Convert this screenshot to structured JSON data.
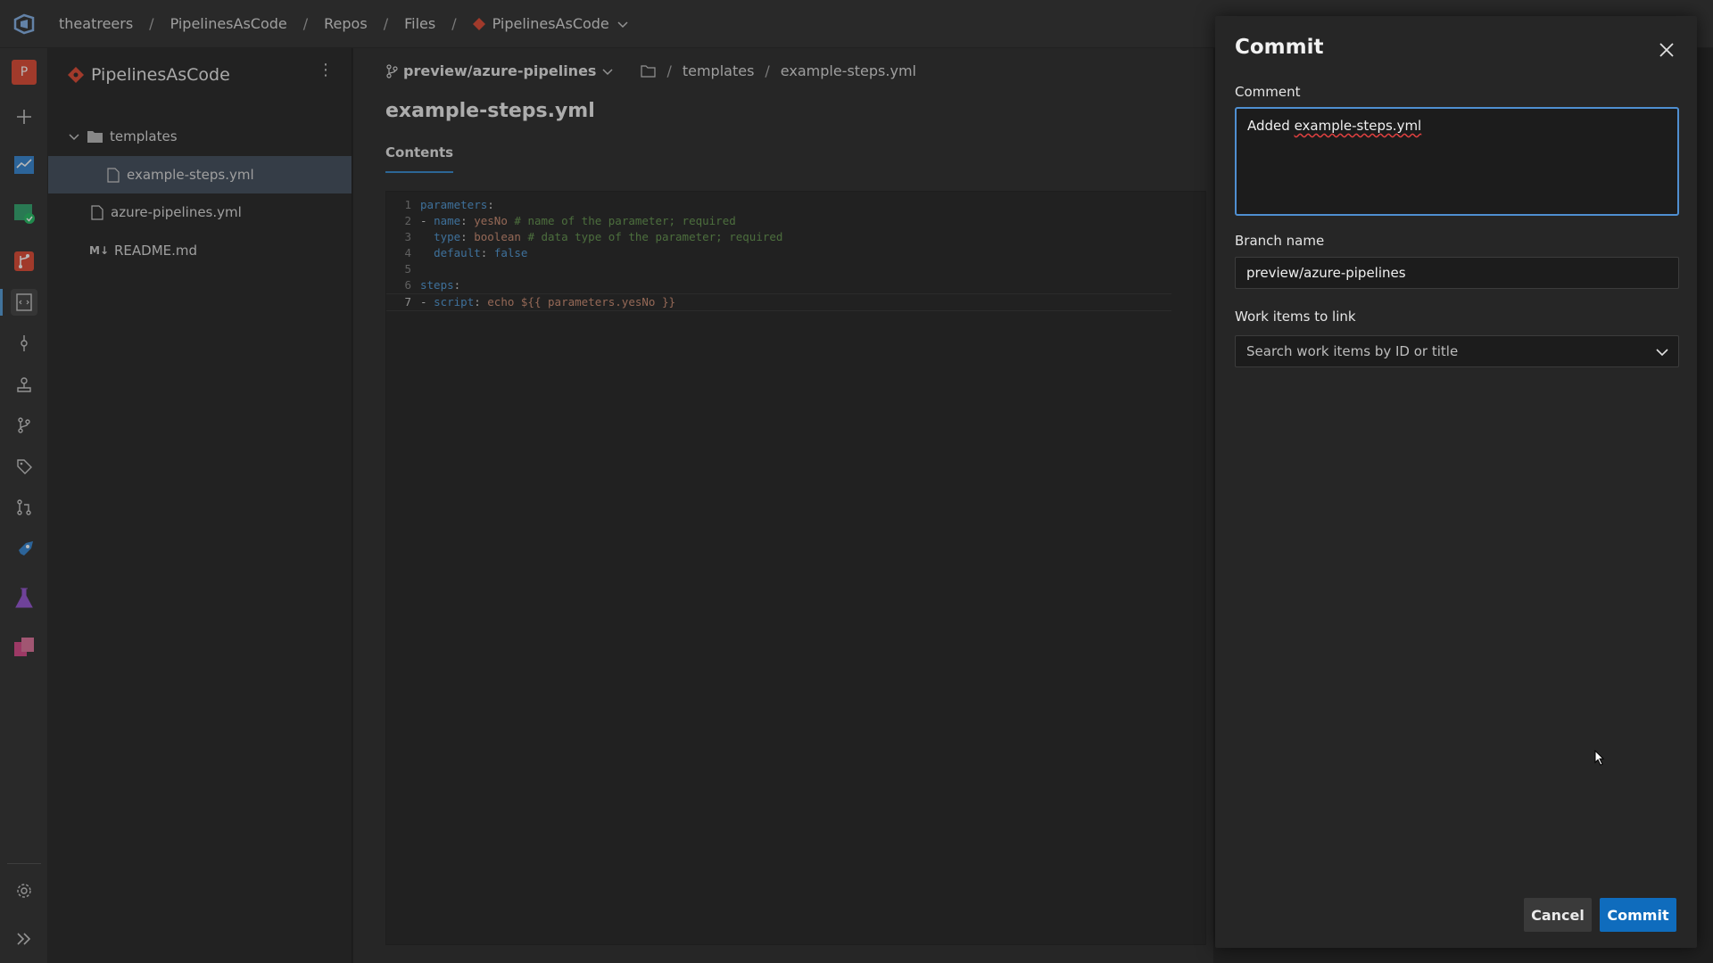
{
  "breadcrumbs": [
    "theatreers",
    "PipelinesAsCode",
    "Repos",
    "Files"
  ],
  "repo_picker": "PipelinesAsCode",
  "rail": {
    "project_badge": "P",
    "icons": [
      "plus-icon",
      "boards-icon",
      "test-plans-check-icon",
      "repos-icon",
      "files-icon",
      "commits-icon",
      "pushes-icon",
      "branches-icon",
      "tags-icon",
      "pull-requests-icon",
      "pipelines-icon",
      "test-beaker-icon",
      "artifacts-icon",
      "settings-icon",
      "expand-icon"
    ]
  },
  "tree": {
    "repo_name": "PipelinesAsCode",
    "folder": "templates",
    "files": [
      {
        "name": "example-steps.yml",
        "selected": true,
        "indent": 2
      },
      {
        "name": "azure-pipelines.yml",
        "selected": false,
        "indent": 1
      },
      {
        "name": "README.md",
        "selected": false,
        "indent": 1
      }
    ]
  },
  "main": {
    "branch": "preview/azure-pipelines",
    "path": [
      "templates",
      "example-steps.yml"
    ],
    "file_title": "example-steps.yml",
    "tab": "Contents",
    "code": {
      "line_numbers": [
        "1",
        "2",
        "3",
        "4",
        "5",
        "6",
        "7"
      ],
      "l1_key": "parameters",
      "l2_key": "name",
      "l2_val": "yesNo",
      "l2_cmt": "# name of the parameter; required",
      "l3_key": "type",
      "l3_val": "boolean",
      "l3_cmt": "# data type of the parameter; required",
      "l4_key": "default",
      "l4_val": "false",
      "l6_key": "steps",
      "l7_key": "script",
      "l7_val": "echo ${{ parameters.yesNo }}"
    }
  },
  "commit_panel": {
    "title": "Commit",
    "comment_label": "Comment",
    "comment_value_prefix": "Added ",
    "comment_value_spell": "example-steps.yml",
    "branch_label": "Branch name",
    "branch_value": "preview/azure-pipelines",
    "work_items_label": "Work items to link",
    "work_items_placeholder": "Search work items by ID or title",
    "cancel_label": "Cancel",
    "commit_label": "Commit"
  },
  "colors": {
    "accent": "#0f6cbd",
    "focus_border": "#4f8fd1",
    "selected_row": "#4a5563"
  }
}
